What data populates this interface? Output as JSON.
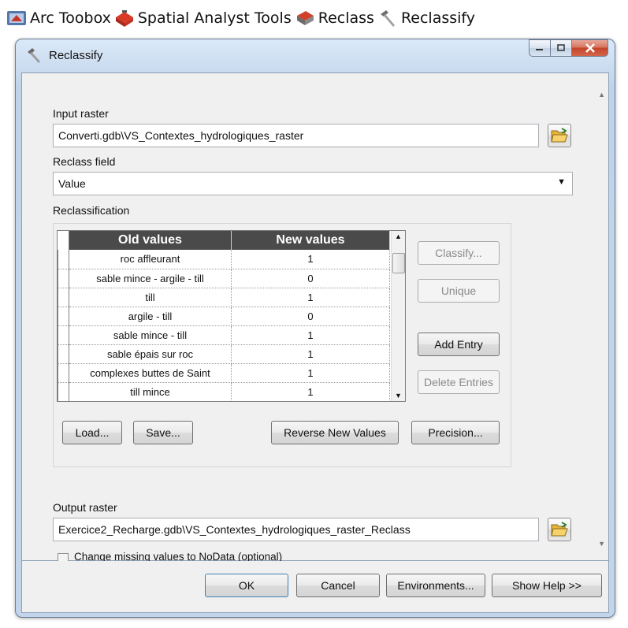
{
  "breadcrumb": {
    "items": [
      {
        "label": "Arc Toobox",
        "icon": "arctoolbox-icon"
      },
      {
        "label": "Spatial Analyst Tools",
        "icon": "toolbox-icon"
      },
      {
        "label": "Reclass",
        "icon": "toolset-icon"
      },
      {
        "label": "Reclassify",
        "icon": "hammer-icon"
      }
    ]
  },
  "window": {
    "title": "Reclassify",
    "controls": {
      "minimize": "minimize-icon",
      "maximize": "maximize-icon",
      "close": "close-icon"
    }
  },
  "form": {
    "input_raster_label": "Input raster",
    "input_raster_value": "Converti.gdb\\VS_Contextes_hydrologiques_raster",
    "reclass_field_label": "Reclass field",
    "reclass_field_value": "Value",
    "reclassification_label": "Reclassification",
    "output_raster_label": "Output raster",
    "output_raster_value": "Exercice2_Recharge.gdb\\VS_Contextes_hydrologiques_raster_Reclass",
    "missing_values_label": "Change missing values to NoData (optional)",
    "missing_values_checked": false
  },
  "table": {
    "headers": [
      "Old values",
      "New values"
    ],
    "rows": [
      [
        "roc affleurant",
        "1"
      ],
      [
        "sable mince - argile - till",
        "0"
      ],
      [
        "till",
        "1"
      ],
      [
        "argile - till",
        "0"
      ],
      [
        "sable mince - till",
        "1"
      ],
      [
        "sable épais sur roc",
        "1"
      ],
      [
        "complexes buttes de Saint",
        "1"
      ],
      [
        "till mince",
        "1"
      ]
    ]
  },
  "buttons": {
    "classify": "Classify...",
    "unique": "Unique",
    "add_entry": "Add Entry",
    "delete_entries": "Delete Entries",
    "load": "Load...",
    "save": "Save...",
    "reverse": "Reverse New Values",
    "precision": "Precision...",
    "ok": "OK",
    "cancel": "Cancel",
    "environments": "Environments...",
    "show_help": "Show Help >>"
  },
  "colors": {
    "header_bg": "#4a4a4a",
    "window_frame": "#c3d5ea",
    "close_button": "#c5452a",
    "folder_yellow": "#f2c14e"
  }
}
